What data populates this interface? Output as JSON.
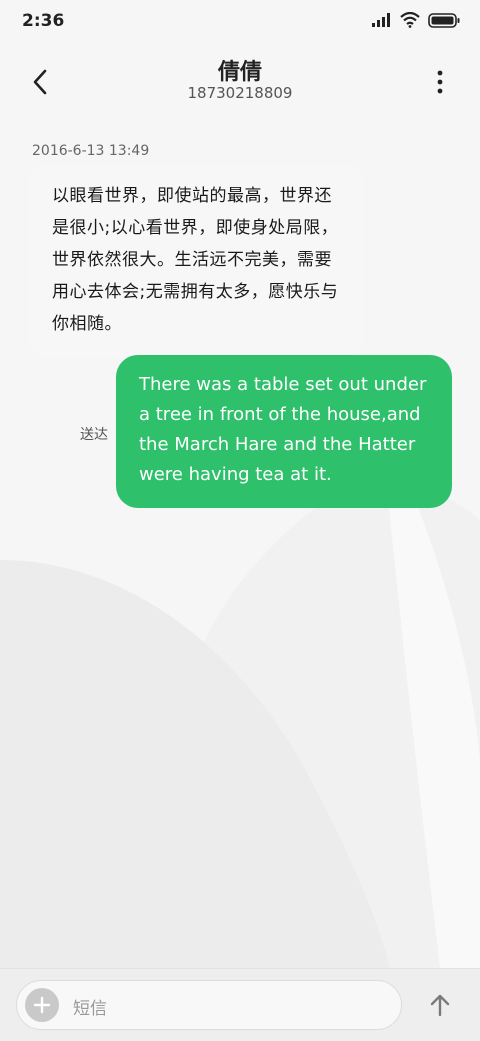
{
  "status_bar": {
    "time": "2:36",
    "icons": [
      "signal-icon",
      "wifi-icon",
      "battery-icon"
    ]
  },
  "header": {
    "contact_name": "倩倩",
    "contact_number": "18730218809",
    "back_icon": "back-arrow-icon",
    "more_icon": "more-vertical-icon"
  },
  "conversation": {
    "timestamp": "2016-6-13 13:49",
    "incoming_message": "以眼看世界，即使站的最高，世界还是很小;以心看世界，即使身处局限，世界依然很大。生活远不完美，需要用心去体会;无需拥有太多，愿快乐与你相随。",
    "outgoing_message": "There was a table set out under a tree in front of the house,and the March Hare and the Hatter were having tea at it.",
    "outgoing_status": "送达"
  },
  "composer": {
    "placeholder": "短信",
    "add_icon": "plus-icon",
    "send_icon": "send-arrow-icon"
  },
  "colors": {
    "outgoing_bubble": "#2fc06c",
    "incoming_bubble": "#f7f7f7",
    "background": "#f0f0f0"
  }
}
